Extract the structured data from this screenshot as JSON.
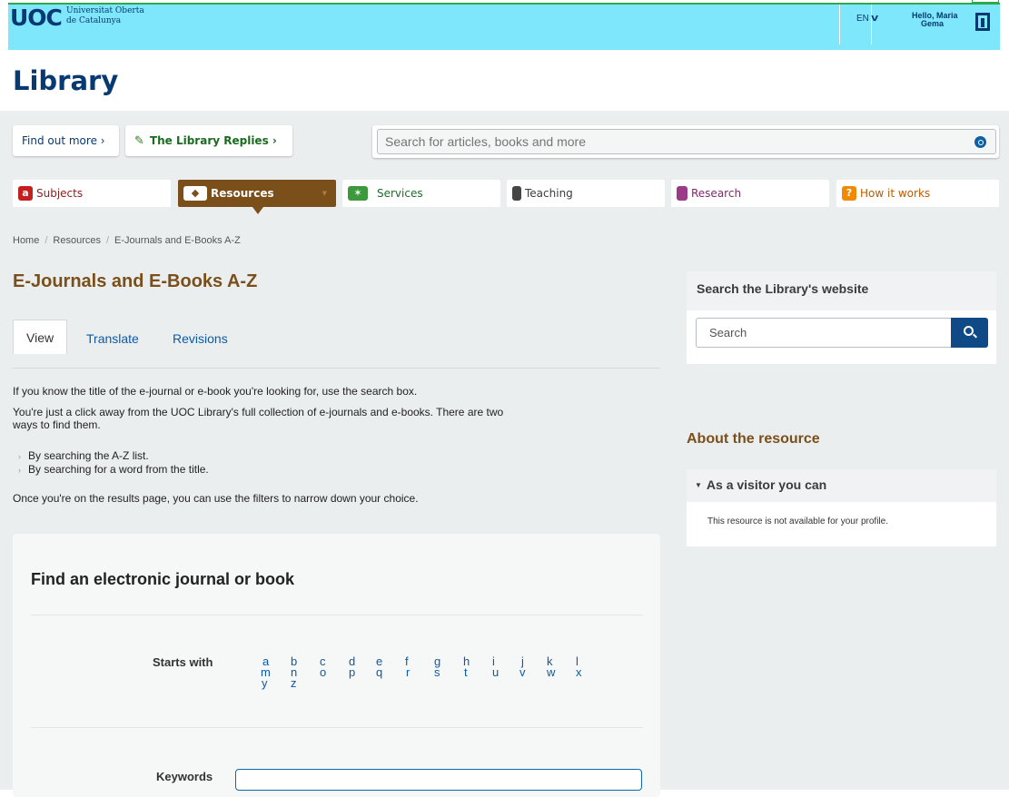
{
  "header": {
    "logo": "UOC",
    "university_line1": "Universitat Oberta",
    "university_line2": "de Catalunya",
    "language": "EN",
    "greeting_line1": "Hello, Maria",
    "greeting_line2": "Gema"
  },
  "site_title": "Library",
  "top_buttons": {
    "find_out_more": "Find out more ›",
    "library_replies": "The Library Replies ›"
  },
  "search": {
    "placeholder": "Search for articles, books and more"
  },
  "nav": {
    "subjects": "Subjects",
    "resources": "Resources",
    "services": "Services",
    "teaching": "Teaching",
    "research": "Research",
    "how_it_works": "How it works"
  },
  "breadcrumb": {
    "home": "Home",
    "resources": "Resources",
    "current": "E-Journals and E-Books A-Z"
  },
  "page_title": "E-Journals and E-Books A-Z",
  "tabs": {
    "view": "View",
    "translate": "Translate",
    "revisions": "Revisions"
  },
  "content": {
    "intro": "If you know the title of the e-journal or e-book you're looking for, use the search box.",
    "para2_line1": "You're just a click away from the UOC Library's full collection of e-journals and e-books. There are two",
    "para2_line2": "ways to find them.",
    "bullet1": "By searching the A-Z list.",
    "bullet2": "By searching for a word from the title.",
    "outro": "Once you're on the results page, you can use the filters to narrow down your choice."
  },
  "find_panel": {
    "title": "Find an electronic journal or book",
    "starts_with_label": "Starts with",
    "letters": [
      "a",
      "b",
      "c",
      "d",
      "e",
      "f",
      "g",
      "h",
      "i",
      "j",
      "k",
      "l",
      "m",
      "n",
      "o",
      "p",
      "q",
      "r",
      "s",
      "t",
      "u",
      "v",
      "w",
      "x",
      "y",
      "z"
    ],
    "keywords_label": "Keywords"
  },
  "sidebar": {
    "search_title": "Search the Library's website",
    "search_placeholder": "Search",
    "about_title": "About the resource",
    "visitor_title": "As a visitor you can",
    "visitor_text": "This resource is not available for your profile."
  }
}
